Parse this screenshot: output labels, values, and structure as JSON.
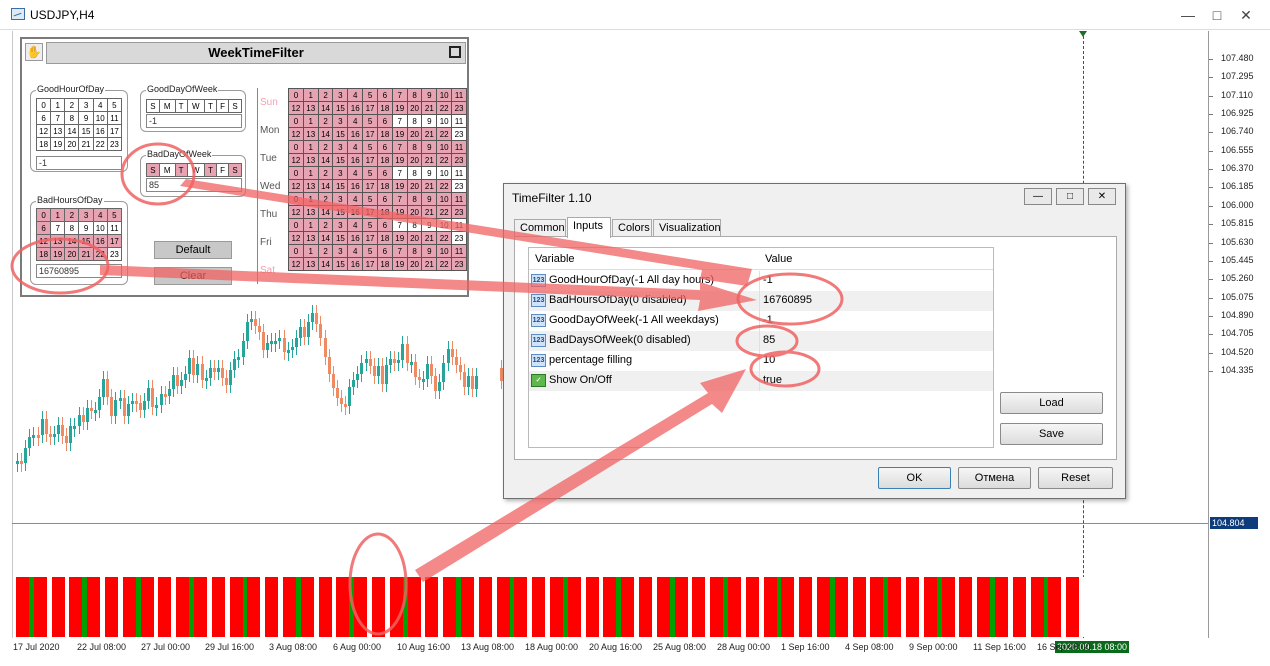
{
  "window": {
    "title": "USDJPY,H4",
    "controls": [
      "minimize",
      "maximize",
      "close"
    ]
  },
  "price_axis": {
    "labels": [
      "107.480",
      "107.295",
      "107.110",
      "106.925",
      "106.740",
      "106.555",
      "106.370",
      "106.185",
      "106.000",
      "105.815",
      "105.630",
      "105.445",
      "105.260",
      "105.075",
      "104.890",
      "104.705",
      "104.520",
      "104.335"
    ],
    "current": "104.804"
  },
  "time_axis": {
    "labels": [
      "17 Jul 2020",
      "22 Jul 08:00",
      "27 Jul 00:00",
      "29 Jul 16:00",
      "3 Aug 08:00",
      "6 Aug 00:00",
      "10 Aug 16:00",
      "13 Aug 08:00",
      "18 Aug 00:00",
      "20 Aug 16:00",
      "25 Aug 08:00",
      "28 Aug 00:00",
      "1 Sep 16:00",
      "4 Sep 08:00",
      "9 Sep 00:00",
      "11 Sep 16:00",
      "16 Sep 08:00"
    ],
    "current": "2020.09.18 08:00"
  },
  "colors": {
    "bull": "#26a69a",
    "bear": "#ef8a62",
    "indicator_bad": "#ff0000",
    "indicator_good": "#00a000",
    "annotation": "#f06262"
  },
  "indicator_bars": {
    "good_fraction": 0.1,
    "pattern_note": "hidden"
  },
  "panel": {
    "title": "WeekTimeFilter",
    "good_hour": {
      "label": "GoodHourOfDay",
      "hours": [
        "0",
        "1",
        "2",
        "3",
        "4",
        "5",
        "6",
        "7",
        "8",
        "9",
        "10",
        "11",
        "12",
        "13",
        "14",
        "15",
        "16",
        "17",
        "18",
        "19",
        "20",
        "21",
        "22",
        "23"
      ],
      "value": "-1"
    },
    "good_day": {
      "label": "GoodDayOfWeek",
      "days": [
        "S",
        "M",
        "T",
        "W",
        "T",
        "F",
        "S"
      ],
      "value": "-1"
    },
    "bad_day": {
      "label": "BadDayOfWeek",
      "days": [
        "S",
        "M",
        "T",
        "W",
        "T",
        "F",
        "S"
      ],
      "value": "85"
    },
    "bad_hours": {
      "label": "BadHoursOfDay",
      "hours": [
        "0",
        "1",
        "2",
        "3",
        "4",
        "5",
        "6",
        "7",
        "8",
        "9",
        "10",
        "11",
        "12",
        "13",
        "14",
        "15",
        "16",
        "17",
        "18",
        "19",
        "20",
        "21",
        "22",
        "23"
      ],
      "value": "16760895"
    },
    "default_label": "Default",
    "clear_label": "Clear",
    "weekdays": [
      "Sun",
      "Mon",
      "Tue",
      "Wed",
      "Thu",
      "Fri",
      "Sat"
    ],
    "hours_row1": [
      "0",
      "1",
      "2",
      "3",
      "4",
      "5",
      "6",
      "7",
      "8",
      "9",
      "10",
      "11"
    ],
    "hours_row2": [
      "12",
      "13",
      "14",
      "15",
      "16",
      "17",
      "18",
      "19",
      "20",
      "21",
      "22",
      "23"
    ]
  },
  "dialog": {
    "title": "TimeFilter 1.10",
    "tabs": [
      "Common",
      "Inputs",
      "Colors",
      "Visualization"
    ],
    "active_tab": "Inputs",
    "col_variable": "Variable",
    "col_value": "Value",
    "params": [
      {
        "name": "GoodHourOfDay(-1 All day hours)",
        "value": "-1",
        "icon": "123"
      },
      {
        "name": "BadHoursOfDay(0 disabled)",
        "value": "16760895",
        "icon": "123"
      },
      {
        "name": "GoodDayOfWeek(-1 All weekdays)",
        "value": "-1",
        "icon": "123"
      },
      {
        "name": "BadDaysOfWeek(0 disabled)",
        "value": "85",
        "icon": "123"
      },
      {
        "name": "percentage filling",
        "value": "10",
        "icon": "123"
      },
      {
        "name": "Show On/Off",
        "value": "true",
        "icon": ""
      }
    ],
    "load_label": "Load",
    "save_label": "Save",
    "ok_label": "OK",
    "cancel_label": "Отмена",
    "reset_label": "Reset"
  }
}
